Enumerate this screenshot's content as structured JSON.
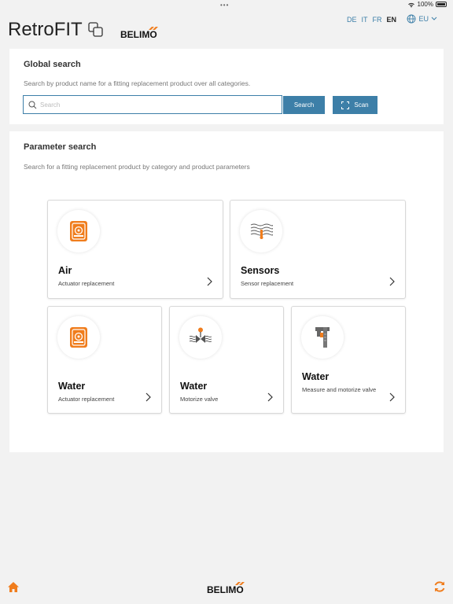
{
  "status": {
    "dots": "•••",
    "battery": "100%"
  },
  "header": {
    "app_title": "RetroFIT",
    "brand": "BELIMO",
    "languages": [
      {
        "code": "DE",
        "active": false
      },
      {
        "code": "IT",
        "active": false
      },
      {
        "code": "FR",
        "active": false
      },
      {
        "code": "EN",
        "active": true
      }
    ],
    "region": "EU"
  },
  "global_search": {
    "title": "Global search",
    "description": "Search by product name for a fitting replacement product over all categories.",
    "placeholder": "Search",
    "search_label": "Search",
    "scan_label": "Scan"
  },
  "parameter_search": {
    "title": "Parameter search",
    "description": "Search for a fitting replacement product by category and product parameters",
    "tiles": [
      {
        "title": "Air",
        "subtitle": "Actuator replacement",
        "icon": "actuator-icon"
      },
      {
        "title": "Sensors",
        "subtitle": "Sensor replacement",
        "icon": "sensor-icon"
      },
      {
        "title": "Water",
        "subtitle": "Actuator replacement",
        "icon": "actuator-icon"
      },
      {
        "title": "Water",
        "subtitle": "Motorize valve",
        "icon": "valve-icon"
      },
      {
        "title": "Water",
        "subtitle": "Measure and motorize valve",
        "icon": "caliper-icon"
      }
    ]
  },
  "bottom_bar": {
    "brand": "BELIMO"
  },
  "colors": {
    "accent": "#3d7fa8",
    "brand_orange": "#f07d1d"
  }
}
